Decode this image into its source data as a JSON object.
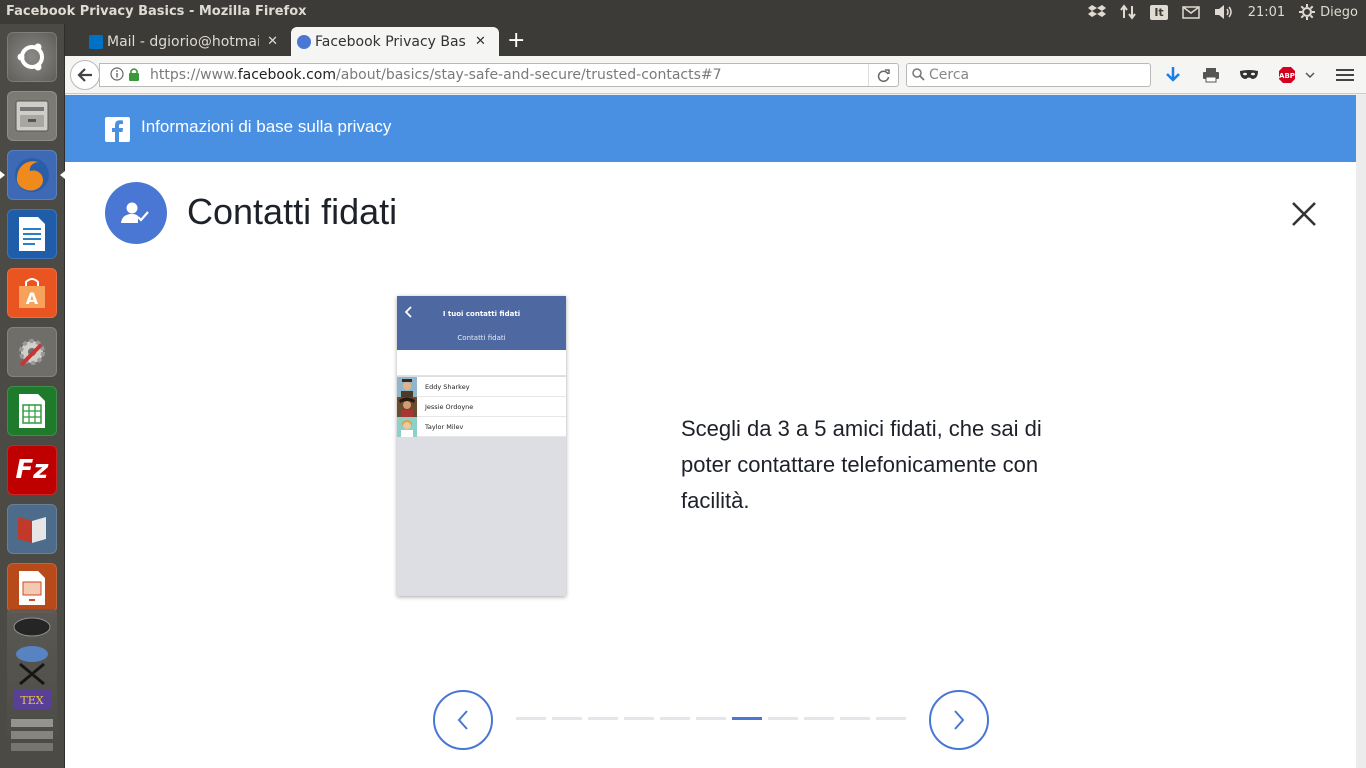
{
  "window": {
    "title": "Facebook Privacy Basics - Mozilla Firefox"
  },
  "panel": {
    "kbd_layout": "It",
    "clock": "21:01",
    "user": "Diego"
  },
  "launcher": {
    "items": [
      {
        "name": "ubuntu-dash-icon",
        "color": "#d9d9d6"
      },
      {
        "name": "files-icon",
        "color": "#8a8a86"
      },
      {
        "name": "firefox-icon",
        "color": "#e66000"
      },
      {
        "name": "writer-icon",
        "color": "#2a7fc7"
      },
      {
        "name": "software-center-icon",
        "color": "#e95420"
      },
      {
        "name": "system-settings-icon",
        "color": "#7d7d7d"
      },
      {
        "name": "calc-icon",
        "color": "#2e9a3a"
      },
      {
        "name": "filezilla-icon",
        "color": "#bf0000"
      },
      {
        "name": "ebook-icon",
        "color": "#c0392b"
      },
      {
        "name": "impress-icon",
        "color": "#d4491a"
      }
    ]
  },
  "tabs": [
    {
      "label": "Mail - dgiorio@hotmai",
      "active": false,
      "close": "✕"
    },
    {
      "label": "Facebook Privacy Basic",
      "active": true,
      "close": "✕"
    }
  ],
  "navbar": {
    "url_prefix": "https://www.",
    "url_domain": "facebook.com",
    "url_path": "/about/basics/stay-safe-and-secure/trusted-contacts#7",
    "search_placeholder": "Cerca"
  },
  "page": {
    "header_title": "Informazioni di base sulla privacy",
    "section_title": "Contatti fidati",
    "description": "Scegli da 3 a 5 amici fidati, che sai di poter contattare telefonicamente con facilità.",
    "phone": {
      "title": "I tuoi contatti fidati",
      "subtitle": "Contatti fidati",
      "contacts": [
        "Eddy Sharkey",
        "Jessie Ordoyne",
        "Taylor Milev"
      ]
    },
    "pagination": {
      "total": 11,
      "current": 7
    }
  },
  "colors": {
    "fb_blue": "#4a90e2",
    "accent": "#4a76d4"
  }
}
